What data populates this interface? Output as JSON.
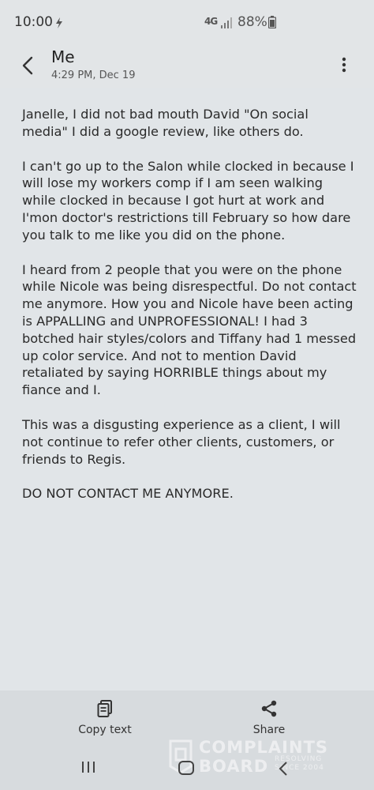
{
  "status_bar": {
    "time": "10:00",
    "network": "4G",
    "battery": "88%"
  },
  "header": {
    "title": "Me",
    "timestamp": "4:29 PM, Dec 19"
  },
  "message": {
    "paragraphs": [
      "Janelle, I did not bad mouth David \"On social media\" I did a google review, like others do.",
      "I can't go up to the Salon while clocked in because I will lose my workers comp if I am seen walking while clocked in because I got hurt at work and I'mon doctor's restrictions till February so how dare you talk to me like you did on the phone.",
      "I heard from 2 people that you were on the phone while Nicole was being disrespectful. Do not contact me anymore. How you and Nicole have been acting is APPALLING and UNPROFESSIONAL! I had 3 botched hair styles/colors and Tiffany had 1 messed up color service. And not to mention David retaliated by saying HORRIBLE things about my fiance and I.",
      "This was a disgusting experience as a client, I will not continue to refer other clients, customers, or friends to Regis.",
      "DO NOT CONTACT ME ANYMORE."
    ]
  },
  "actions": {
    "copy_label": "Copy text",
    "share_label": "Share"
  },
  "watermark": {
    "line1": "COMPLAINTS",
    "line2": "BOARD",
    "tag1": "RESOLVING",
    "tag2": "SINCE 2004"
  }
}
